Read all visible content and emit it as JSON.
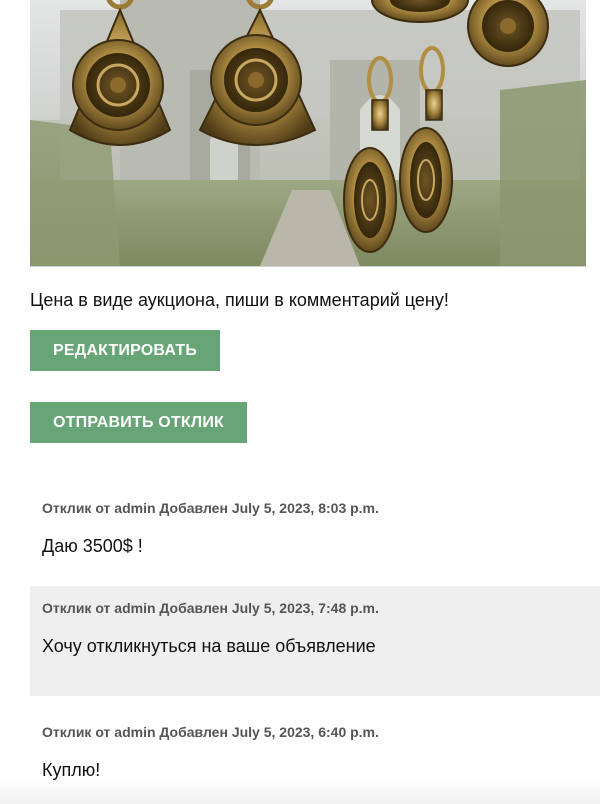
{
  "listing": {
    "image": {
      "alt": "earrings-photo"
    },
    "description": "Цена в виде аукциона, пиши в комментарий цену!"
  },
  "actions": {
    "edit_label": "РЕДАКТИРОВАТЬ",
    "respond_label": "ОТПРАВИТЬ ОТКЛИК"
  },
  "responses": [
    {
      "prefix": "Отклик от",
      "author": "admin",
      "added_label": "Добавлен",
      "date": "July 5, 2023, 8:03 p.m.",
      "text": "Даю 3500$ !"
    },
    {
      "prefix": "Отклик от",
      "author": "admin",
      "added_label": "Добавлен",
      "date": "July 5, 2023, 7:48 p.m.",
      "text": "Хочу откликнуться на ваше объявление"
    },
    {
      "prefix": "Отклик от",
      "author": "admin",
      "added_label": "Добавлен",
      "date": "July 5, 2023, 6:40 p.m.",
      "text": "Куплю!"
    }
  ],
  "colors": {
    "button": "#67a576",
    "button_text": "#ffffff",
    "alt_row": "#efefef",
    "meta_text": "#555555"
  }
}
